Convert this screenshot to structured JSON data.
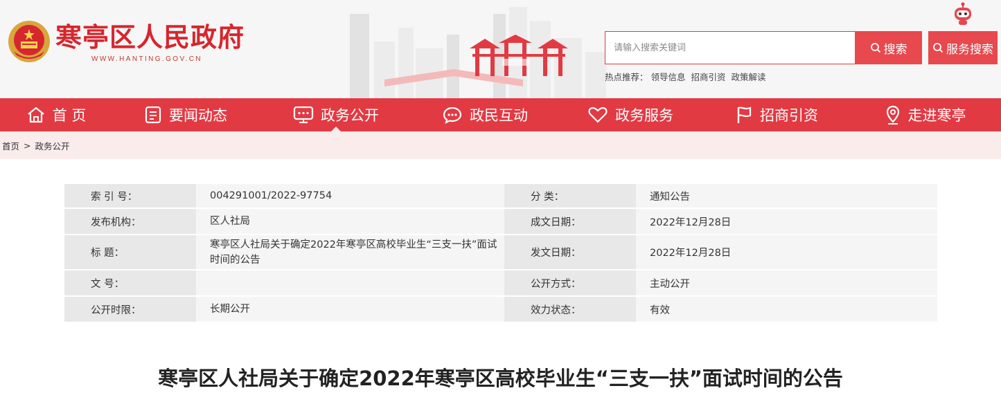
{
  "site": {
    "title": "寒亭区人民政府",
    "url": "WWW.HANTING.GOV.CN",
    "brand_color": "#e23a43"
  },
  "search": {
    "placeholder": "请输入搜索关键词",
    "search_label": "搜索",
    "service_label": "服务搜索",
    "hot_label": "热点推荐：",
    "hot_links": [
      "领导信息",
      "招商引资",
      "政策解读"
    ]
  },
  "nav": [
    {
      "label": "首 页",
      "icon": "home-icon"
    },
    {
      "label": "要闻动态",
      "icon": "news-icon"
    },
    {
      "label": "政务公开",
      "icon": "screen-icon",
      "active": true
    },
    {
      "label": "政民互动",
      "icon": "chat-icon"
    },
    {
      "label": "政务服务",
      "icon": "heart-icon"
    },
    {
      "label": "招商引资",
      "icon": "flag-icon"
    },
    {
      "label": "走进寒亭",
      "icon": "location-icon"
    }
  ],
  "breadcrumb": {
    "home": "首页",
    "separator": ">",
    "current": "政务公开"
  },
  "meta": {
    "rows": [
      {
        "l1": "索 引 号：",
        "v1": "004291001/2022-97754",
        "l2": "分        类：",
        "v2": "通知公告"
      },
      {
        "l1": "发布机构：",
        "v1": "区人社局",
        "l2": "成文日期：",
        "v2": "2022年12月28日"
      },
      {
        "l1": "标        题：",
        "v1": "寒亭区人社局关于确定2022年寒亭区高校毕业生“三支一扶”面试时间的公告",
        "l2": "发文日期：",
        "v2": "2022年12月28日"
      },
      {
        "l1": "文        号：",
        "v1": "",
        "l2": "公开方式：",
        "v2": "主动公开"
      },
      {
        "l1": "公开时限：",
        "v1": "长期公开",
        "l2": "效力状态：",
        "v2": "有效"
      }
    ]
  },
  "article": {
    "title": "寒亭区人社局关于确定2022年寒亭区高校毕业生“三支一扶”面试时间的公告"
  }
}
